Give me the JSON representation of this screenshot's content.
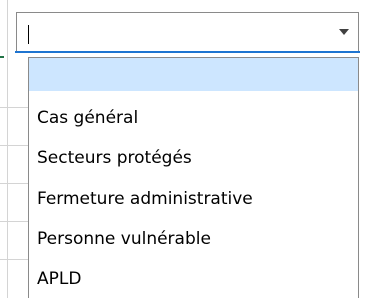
{
  "combobox": {
    "value": "",
    "arrow_icon": "chevron-down-icon",
    "focus_color": "#1e74d0"
  },
  "dropdown": {
    "selected_index": 0,
    "highlight_color": "#cde6ff",
    "options": [
      "",
      "Cas général",
      "Secteurs protégés",
      "Fermeture administrative",
      "Personne vulnérable",
      "APLD"
    ]
  }
}
